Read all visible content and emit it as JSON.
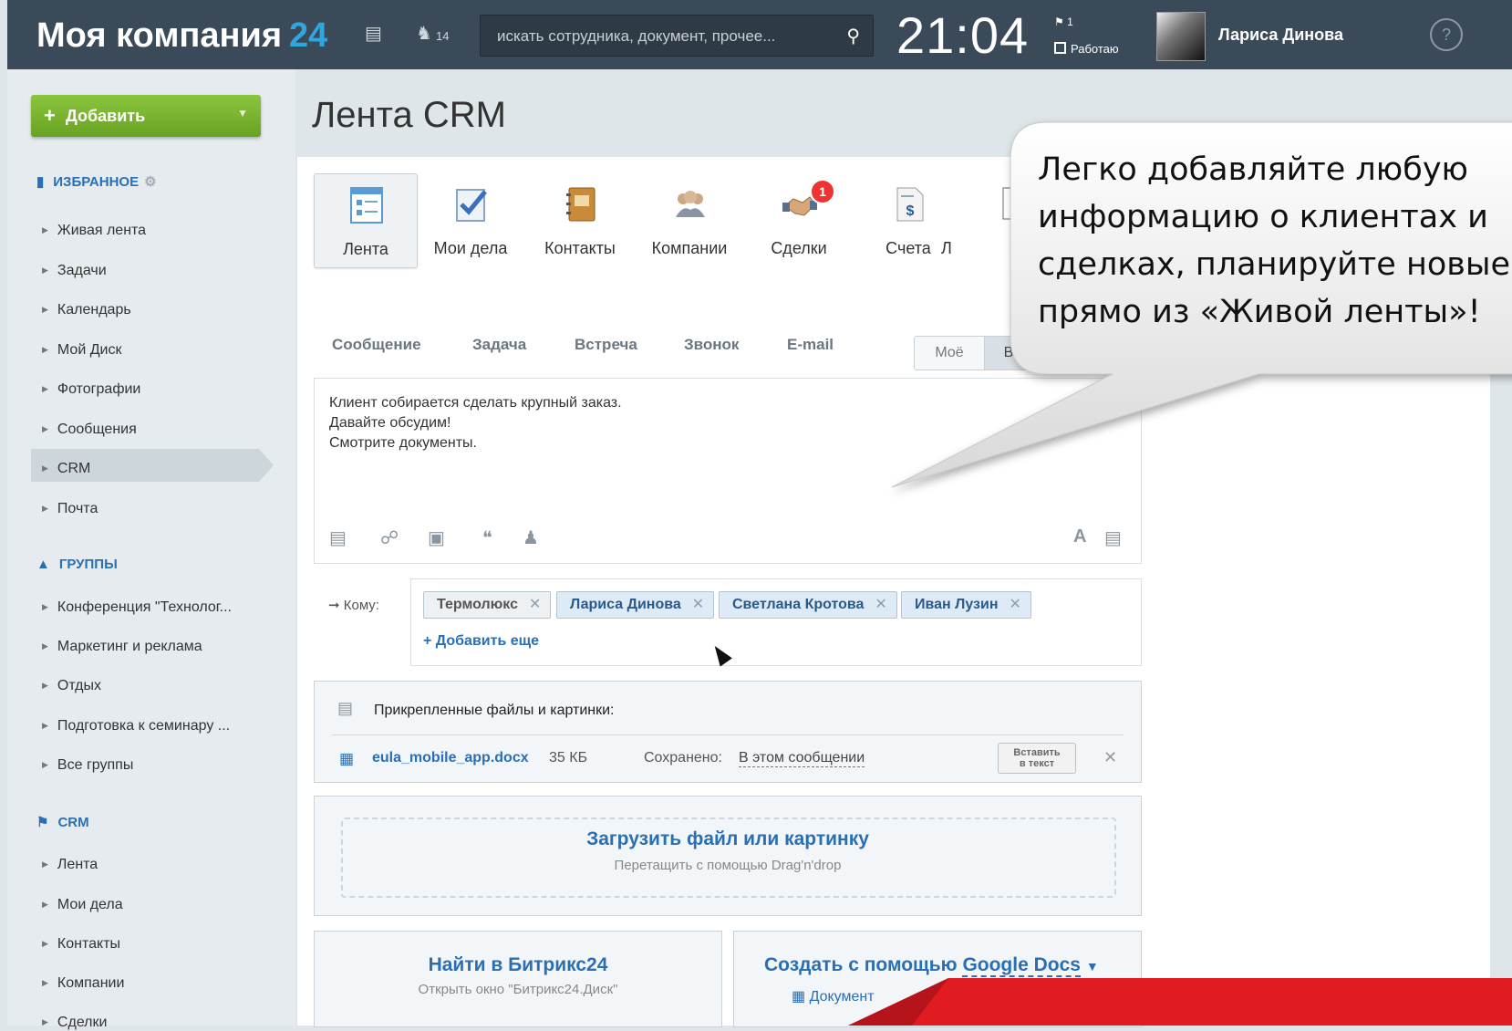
{
  "header": {
    "logo_text": "Моя компания",
    "logo_num": "24",
    "notifications_count": "14",
    "search_placeholder": "искать сотрудника, документ, прочее...",
    "clock": "21:04",
    "flag_count": "1",
    "work_status": "Работаю",
    "user_name": "Лариса Динова",
    "help": "?"
  },
  "sidebar": {
    "add_button": "Добавить",
    "favorites_title": "ИЗБРАННОЕ",
    "favorites": [
      "Живая лента",
      "Задачи",
      "Календарь",
      "Мой Диск",
      "Фотографии",
      "Сообщения",
      "CRM",
      "Почта"
    ],
    "groups_title": "ГРУППЫ",
    "groups": [
      "Конференция \"Технолог...",
      "Маркетинг и реклама",
      "Отдых",
      "Подготовка к семинару ...",
      "Все группы"
    ],
    "crm_title": "CRM",
    "crm_items": [
      "Лента",
      "Мои дела",
      "Контакты",
      "Компании",
      "Сделки"
    ]
  },
  "page_title": "Лента CRM",
  "crm_tabs": [
    "Лента",
    "Мои дела",
    "Контакты",
    "Компании",
    "Сделки",
    "Счета",
    "Л"
  ],
  "deals_badge": "1",
  "message_tabs": [
    "Сообщение",
    "Задача",
    "Встреча",
    "Звонок",
    "E-mail"
  ],
  "visibility": {
    "mine": "Моё",
    "all": "Вс"
  },
  "editor_text": "Клиент собирается сделать крупный заказ.\nДавайте обсудим!\nСмотрите документы.",
  "editor_format_label": "A",
  "recipients": {
    "label": "Кому:",
    "chips": [
      "Термолюкс",
      "Лариса Динова",
      "Светлана Кротова",
      "Иван Лузин"
    ],
    "add_more": "Добавить еще"
  },
  "attachments": {
    "title": "Прикрепленные файлы и картинки:",
    "file_name": "eula_mobile_app.docx",
    "file_size": "35 КБ",
    "saved_label": "Сохранено:",
    "saved_value": "В этом сообщении",
    "insert_btn_line1": "Вставить",
    "insert_btn_line2": "в текст"
  },
  "upload": {
    "title": "Загрузить файл или картинку",
    "subtitle": "Перетащить с помощью Drag'n'drop"
  },
  "find": {
    "title": "Найти в Битрикс24",
    "subtitle": "Открыть окно \"Битрикс24.Диск\""
  },
  "gdocs": {
    "title_prefix": "Создать с помощью",
    "title_link": "Google Docs",
    "document": "Документ"
  },
  "callout_text": "Легко добавляйте любую\nинформацию о клиентах и\nсделках, планируйте новые дела\nпрямо из «Живой ленты»!",
  "colors": {
    "accent": "#2a6fb4",
    "topbar": "#3a4a58",
    "add_green": "#7ab531",
    "highlight_red": "#e01b22"
  }
}
